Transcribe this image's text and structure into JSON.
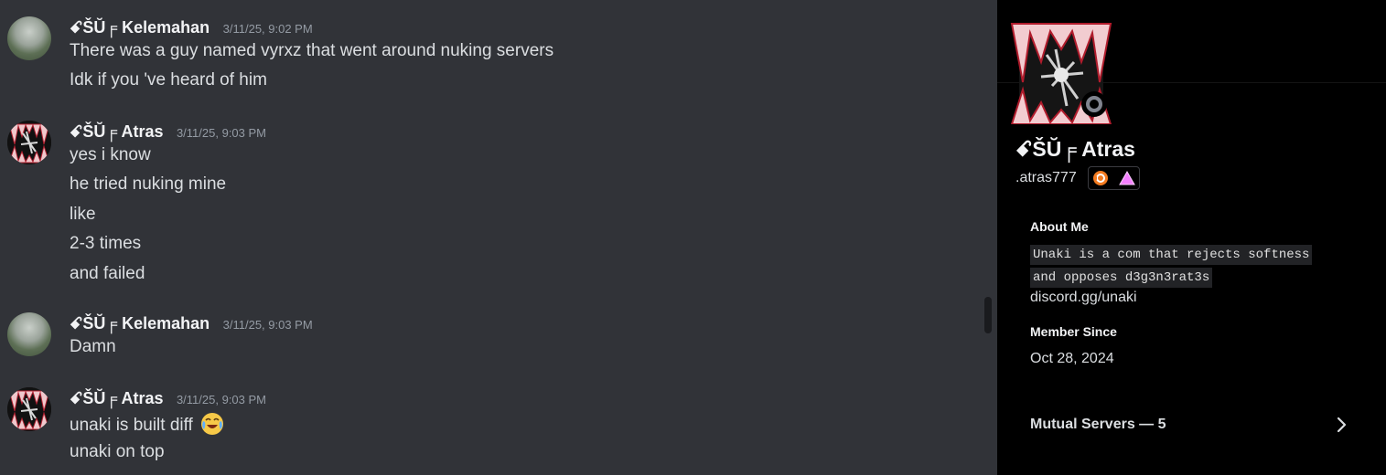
{
  "messages": [
    {
      "author": "ꗃŠŬ╒ Kelemahan",
      "timestamp": "3/11/25, 9:02 PM",
      "lines": [
        "There was a guy named vyrxz that went around nuking servers",
        "Idk if you 've heard of him"
      ]
    },
    {
      "author": "ꗃŠŬ╒ Atras",
      "timestamp": "3/11/25, 9:03 PM",
      "lines": [
        "yes i know",
        "he tried nuking mine",
        "like",
        "2-3 times",
        "and failed"
      ]
    },
    {
      "author": "ꗃŠŬ╒ Kelemahan",
      "timestamp": "3/11/25, 9:03 PM",
      "lines": [
        "Damn"
      ]
    },
    {
      "author": "ꗃŠŬ╒ Atras",
      "timestamp": "3/11/25, 9:03 PM",
      "lines": [
        "unaki is built diff",
        "unaki on top"
      ],
      "emoji": "joy-emoji"
    }
  ],
  "profile": {
    "display_name": "ꗃŠŬ╒ Atras",
    "handle": ".atras777",
    "badges": [
      "hypesquad-badge",
      "nitro-badge"
    ],
    "status": "offline",
    "about_title": "About Me",
    "about_code_1": "Unaki is a com that rejects softness",
    "about_code_2": "and opposes d3g3n3rat3s",
    "about_link": "discord.gg/unaki",
    "member_since_title": "Member Since",
    "member_since": "Oct 28, 2024",
    "mutual_servers": "Mutual Servers — 5"
  },
  "colors": {
    "chat_bg": "#313338",
    "panel_bg": "#000000",
    "text": "#dbdee1",
    "muted": "#949ba4"
  }
}
